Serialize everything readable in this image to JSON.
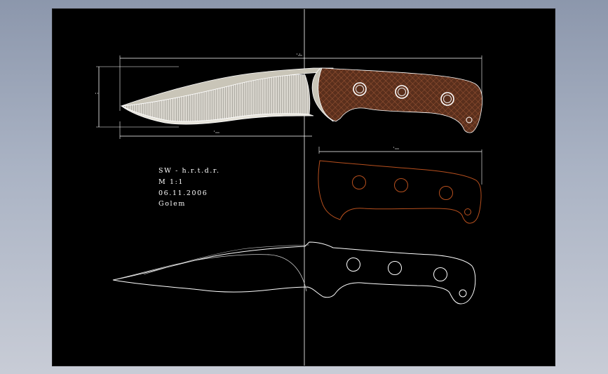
{
  "drawing_notes": {
    "author": "SW - h.r.t.d.r.",
    "scale": "M 1:1",
    "date": "06.11.2006",
    "name": "Golem"
  },
  "colors": {
    "background": "#000000",
    "line": "#ffffff",
    "blade_fill": "#c9c5b8",
    "grind_fill": "#d9d6ce",
    "handle_fill": "#5a2f1c",
    "handle_hatch": "#8a4a2c",
    "scale_outline": "#b8501e"
  }
}
